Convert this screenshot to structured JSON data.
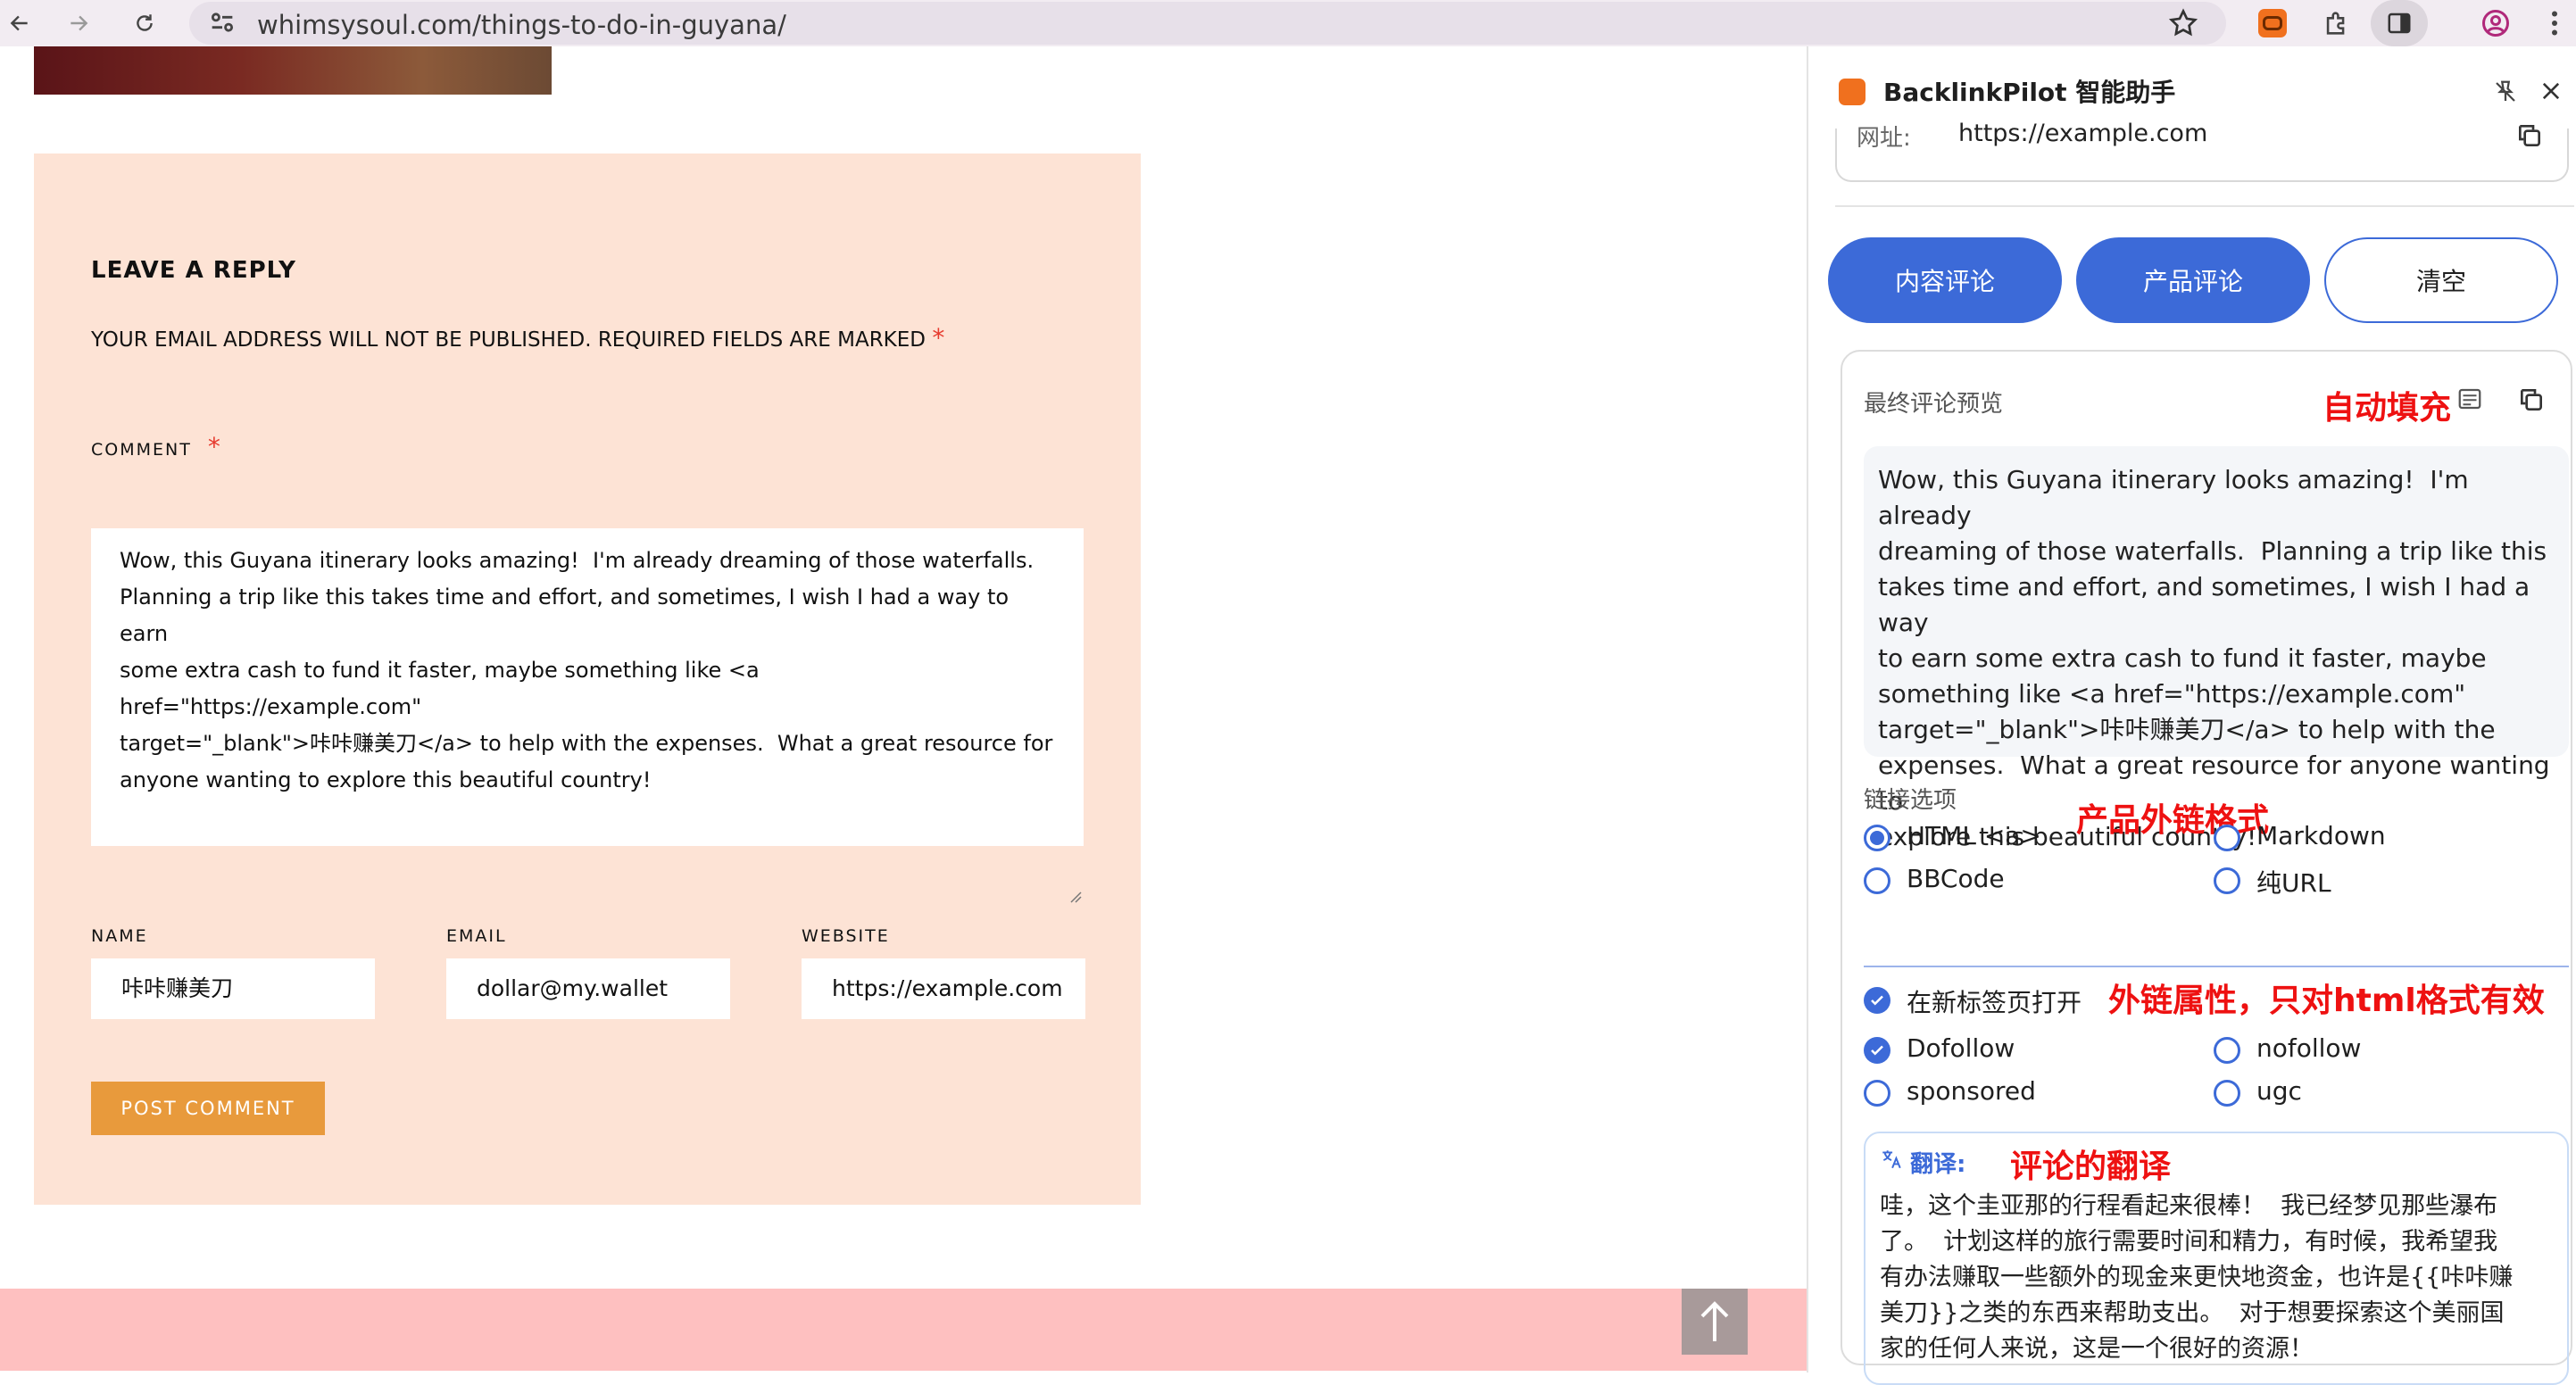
{
  "browser": {
    "url": "whimsysoul.com/things-to-do-in-guyana/"
  },
  "page": {
    "reply_title": "LEAVE A REPLY",
    "notice": "YOUR EMAIL ADDRESS WILL NOT BE PUBLISHED. REQUIRED FIELDS ARE MARKED",
    "required_mark": "*",
    "comment_label": "COMMENT",
    "comment_text": "Wow, this Guyana itinerary looks amazing!  I'm already dreaming of those waterfalls.\nPlanning a trip like this takes time and effort, and sometimes, I wish I had a way to earn\nsome extra cash to fund it faster, maybe something like <a href=\"https://example.com\"\ntarget=\"_blank\">咔咔赚美刀</a> to help with the expenses.  What a great resource for\nanyone wanting to explore this beautiful country!",
    "name_label": "NAME",
    "name_value": "咔咔赚美刀",
    "email_label": "EMAIL",
    "email_value": "dollar@my.wallet",
    "website_label": "WEBSITE",
    "website_value": "https://example.com",
    "post_button": "POST COMMENT"
  },
  "panel": {
    "title": "BacklinkPilot 智能助手",
    "url_label": "网址:",
    "url_value": "https://example.com",
    "buttons": {
      "content_comment": "内容评论",
      "product_comment": "产品评论",
      "clear": "清空"
    },
    "preview_title": "最终评论预览",
    "preview_text": "Wow, this Guyana itinerary looks amazing!  I'm already\ndreaming of those waterfalls.  Planning a trip like this\ntakes time and effort, and sometimes, I wish I had a way\nto earn some extra cash to fund it faster, maybe\nsomething like <a href=\"https://example.com\"\ntarget=\"_blank\">咔咔赚美刀</a> to help with the\nexpenses.  What a great resource for anyone wanting to\nexplore this beautiful country!",
    "link_options_title": "链接选项",
    "format_options": [
      {
        "label": "HTML <a>",
        "selected": true
      },
      {
        "label": "Markdown",
        "selected": false
      },
      {
        "label": "BBCode",
        "selected": false
      },
      {
        "label": "纯URL",
        "selected": false
      }
    ],
    "open_new_tab": {
      "label": "在新标签页打开",
      "checked": true
    },
    "rel_options": [
      {
        "label": "Dofollow",
        "selected": true
      },
      {
        "label": "nofollow",
        "selected": false
      },
      {
        "label": "sponsored",
        "selected": false
      },
      {
        "label": "ugc",
        "selected": false
      }
    ],
    "translation_label": "翻译:",
    "translation_text": "哇，这个圭亚那的行程看起来很棒！  我已经梦见那些瀑布\n了。  计划这样的旅行需要时间和精力，有时候，我希望我\n有办法赚取一些额外的现金来更快地资金，也许是{{咔咔赚\n美刀}}之类的东西来帮助支出。  对于想要探索这个美丽国\n家的任何人来说，这是一个很好的资源！"
  },
  "annotations": {
    "autofill": "自动填充",
    "link_format": "产品外链格式",
    "link_attr": "外链属性，只对html格式有效",
    "translation": "评论的翻译"
  },
  "colors": {
    "accent_blue": "#3c6ad8",
    "annotation_red": "#ee1111",
    "reply_bg": "#fde3d5",
    "post_btn": "#e89a3c"
  }
}
